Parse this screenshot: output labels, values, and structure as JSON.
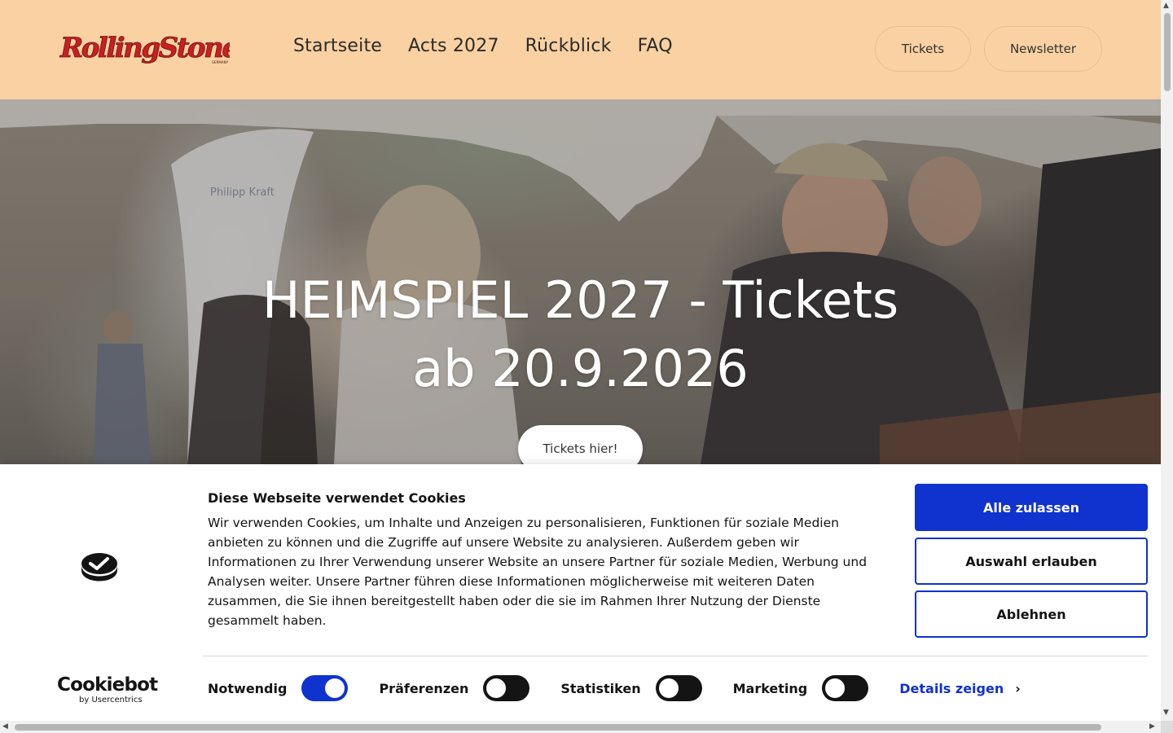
{
  "header": {
    "logo_alt": "Rolling Stone",
    "nav": [
      {
        "label": "Startseite"
      },
      {
        "label": "Acts 2027"
      },
      {
        "label": "Rückblick"
      },
      {
        "label": "FAQ"
      }
    ],
    "tickets_label": "Tickets",
    "newsletter_label": "Newsletter"
  },
  "hero": {
    "title_line1": "HEIMSPIEL 2027 - Tickets",
    "title_line2": "ab 20.9.2026",
    "cta_label": "Tickets hier!"
  },
  "cookie": {
    "title": "Diese Webseite verwendet Cookies",
    "text": "Wir verwenden Cookies, um Inhalte und Anzeigen zu personalisieren, Funktionen für soziale Medien anbieten zu können und die Zugriffe auf unsere Website zu analysieren. Außerdem geben wir Informationen zu Ihrer Verwendung unserer Website an unsere Partner für soziale Medien, Werbung und Analysen weiter. Unsere Partner führen diese Informationen möglicherweise mit weiteren Daten zusammen, die Sie ihnen bereitgestellt haben oder die sie im Rahmen Ihrer Nutzung der Dienste gesammelt haben.",
    "btn_allow_all": "Alle zulassen",
    "btn_allow_selection": "Auswahl erlauben",
    "btn_deny": "Ablehnen",
    "brand_word": "Cookiebot",
    "brand_by": "by Usercentrics",
    "toggles": [
      {
        "label": "Notwendig",
        "on": true
      },
      {
        "label": "Präferenzen",
        "on": false
      },
      {
        "label": "Statistiken",
        "on": false
      },
      {
        "label": "Marketing",
        "on": false
      }
    ],
    "details_label": "Details zeigen",
    "colors": {
      "accent": "#1032cf",
      "header_bg": "#f9d1a2"
    }
  }
}
